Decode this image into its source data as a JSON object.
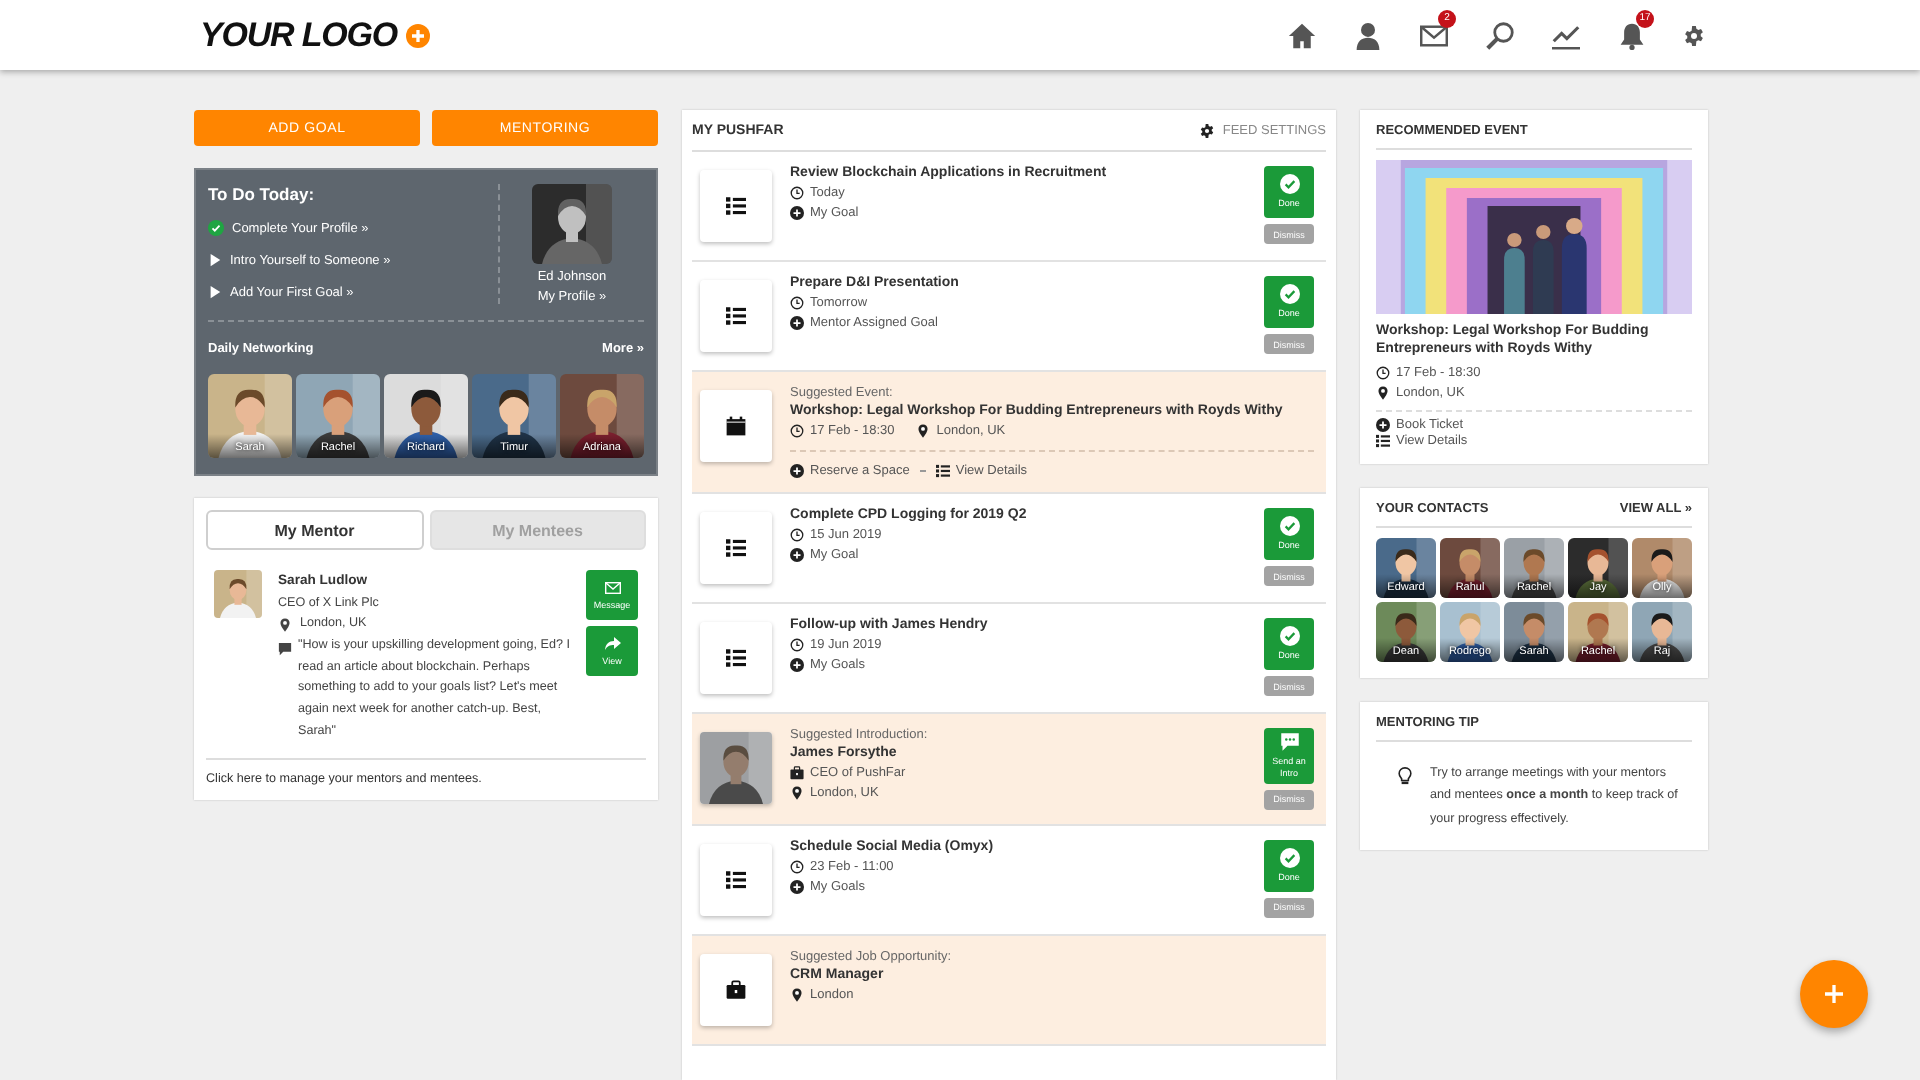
{
  "header": {
    "logo": "YOUR LOGO",
    "mail_badge": "2",
    "notifications_badge": "17"
  },
  "left": {
    "buttons": [
      "ADD GOAL",
      "MENTORING"
    ],
    "todo": {
      "title": "To Do Today:",
      "items": [
        {
          "text": "Complete Your Profile »",
          "done": true
        },
        {
          "text": "Intro Yourself to Someone »",
          "done": false
        },
        {
          "text": "Add Your First Goal »",
          "done": false
        }
      ],
      "profile": {
        "name": "Ed Johnson",
        "link": "My Profile »"
      }
    },
    "networking": {
      "title": "Daily Networking",
      "more": "More »",
      "people": [
        {
          "name": "Sarah"
        },
        {
          "name": "Rachel"
        },
        {
          "name": "Richard"
        },
        {
          "name": "Timur"
        },
        {
          "name": "Adriana"
        }
      ]
    },
    "mentor_card": {
      "tabs": [
        {
          "label": "My Mentor",
          "selected": true
        },
        {
          "label": "My Mentees",
          "selected": false
        }
      ],
      "name": "Sarah Ludlow",
      "role": "CEO of X Link Plc",
      "location": "London, UK",
      "message": "\"How is your upskilling development going, Ed? I read an article about blockchain. Perhaps something to add to your goals list? Let's meet again next week for another catch-up. Best, Sarah\"",
      "buttons": [
        "Message",
        "View"
      ],
      "footer": "Click here to manage your mentors and mentees."
    }
  },
  "feed": {
    "title": "MY PUSHFAR",
    "settings": "FEED SETTINGS",
    "items": [
      {
        "kind": "goal",
        "title": "Review Blockchain Applications in Recruitment",
        "time": "Today",
        "category": "My Goal",
        "done": "Done",
        "dismiss": "Dismiss"
      },
      {
        "kind": "goal",
        "title": "Prepare D&I Presentation",
        "time": "Tomorrow",
        "category": "Mentor Assigned Goal",
        "done": "Done",
        "dismiss": "Dismiss"
      },
      {
        "kind": "event",
        "label": "Suggested Event:",
        "title": "Workshop: Legal Workshop For Budding Entrepreneurs with Royds Withy",
        "time": "17 Feb - 18:30",
        "location": "London, UK",
        "actions": [
          "Reserve a Space",
          "View Details"
        ]
      },
      {
        "kind": "goal",
        "title": "Complete CPD Logging for 2019 Q2",
        "time": "15 Jun 2019",
        "category": "My Goal",
        "done": "Done",
        "dismiss": "Dismiss"
      },
      {
        "kind": "goal",
        "title": "Follow-up with James Hendry",
        "time": "19 Jun 2019",
        "category": "My Goals",
        "done": "Done",
        "dismiss": "Dismiss"
      },
      {
        "kind": "intro",
        "label": "Suggested Introduction:",
        "title": "James Forsythe",
        "role": "CEO of PushFar",
        "location": "London, UK",
        "done": "Send an Intro",
        "dismiss": "Dismiss"
      },
      {
        "kind": "goal",
        "title": "Schedule Social Media (Omyx)",
        "time": "23 Feb - 11:00",
        "category": "My Goals",
        "done": "Done",
        "dismiss": "Dismiss"
      },
      {
        "kind": "job",
        "label": "Suggested Job Opportunity:",
        "title": "CRM Manager",
        "location": "London"
      }
    ]
  },
  "recommended_event": {
    "heading": "RECOMMENDED EVENT",
    "title": "Workshop: Legal Workshop For Budding Entrepreneurs with Royds Withy",
    "time": "17 Feb - 18:30",
    "location": "London, UK",
    "actions": [
      "Book Ticket",
      "View Details"
    ]
  },
  "contacts": {
    "heading": "YOUR CONTACTS",
    "view_all": "VIEW ALL »",
    "people": [
      {
        "name": "Edward"
      },
      {
        "name": "Rahul"
      },
      {
        "name": "Rachel"
      },
      {
        "name": "Jay"
      },
      {
        "name": "Olly"
      },
      {
        "name": "Dean"
      },
      {
        "name": "Rodrego"
      },
      {
        "name": "Sarah"
      },
      {
        "name": "Rachel"
      },
      {
        "name": "Raj"
      }
    ]
  },
  "tip": {
    "heading": "MENTORING TIP",
    "text": "Try to arrange meetings with your mentors and mentees **once a month** to keep track of your progress effectively."
  }
}
